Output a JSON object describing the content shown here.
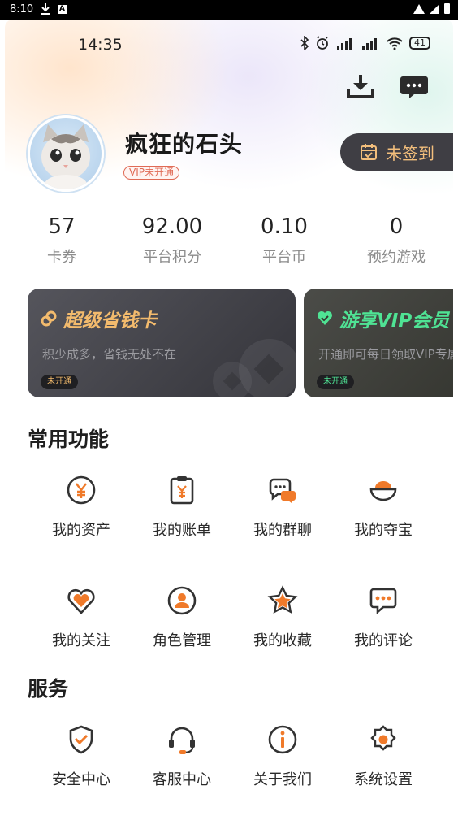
{
  "system_bar": {
    "time": "8:10"
  },
  "inner_status": {
    "time": "14:35",
    "battery": "41"
  },
  "profile": {
    "username": "疯狂的石头",
    "vip_status": "VIP未开通",
    "signin_label": "未签到"
  },
  "stats": [
    {
      "value": "57",
      "label": "卡券"
    },
    {
      "value": "92.00",
      "label": "平台积分"
    },
    {
      "value": "0.10",
      "label": "平台币"
    },
    {
      "value": "0",
      "label": "预约游戏"
    }
  ],
  "cards": [
    {
      "title": "超级省钱卡",
      "desc": "积少成多，省钱无处不在",
      "tag": "未开通"
    },
    {
      "title": "游享VIP会员",
      "desc": "开通即可每日领取VIP专属福利",
      "tag": "未开通"
    }
  ],
  "sections": {
    "common": "常用功能",
    "services": "服务"
  },
  "common_items": [
    {
      "label": "我的资产",
      "icon": "yuan-coin-icon"
    },
    {
      "label": "我的账单",
      "icon": "bill-icon"
    },
    {
      "label": "我的群聊",
      "icon": "group-chat-icon"
    },
    {
      "label": "我的夺宝",
      "icon": "treasure-bowl-icon"
    },
    {
      "label": "我的关注",
      "icon": "heart-icon"
    },
    {
      "label": "角色管理",
      "icon": "user-role-icon"
    },
    {
      "label": "我的收藏",
      "icon": "star-icon"
    },
    {
      "label": "我的评论",
      "icon": "comment-icon"
    }
  ],
  "service_items": [
    {
      "label": "安全中心",
      "icon": "shield-icon"
    },
    {
      "label": "客服中心",
      "icon": "headset-icon"
    },
    {
      "label": "关于我们",
      "icon": "info-icon"
    },
    {
      "label": "系统设置",
      "icon": "settings-gear-icon"
    }
  ],
  "colors": {
    "accent_orange": "#f07a2a",
    "icon_dark": "#333333",
    "gold": "#f3bb6d",
    "green": "#4fe394"
  }
}
